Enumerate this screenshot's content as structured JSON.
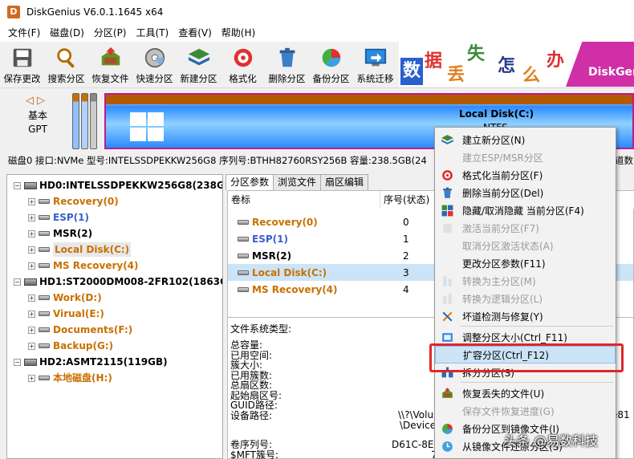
{
  "window": {
    "title": "DiskGenius V6.0.1.1645 x64",
    "logo_letter": "D"
  },
  "menu": [
    "文件(F)",
    "磁盘(D)",
    "分区(P)",
    "工具(T)",
    "查看(V)",
    "帮助(H)"
  ],
  "toolbar": [
    {
      "label": "保存更改",
      "icon": "save-icon"
    },
    {
      "label": "搜索分区",
      "icon": "search-icon"
    },
    {
      "label": "恢复文件",
      "icon": "recover-icon"
    },
    {
      "label": "快速分区",
      "icon": "quick-partition-icon"
    },
    {
      "label": "新建分区",
      "icon": "new-partition-icon"
    },
    {
      "label": "格式化",
      "icon": "format-icon"
    },
    {
      "label": "删除分区",
      "icon": "delete-icon"
    },
    {
      "label": "备份分区",
      "icon": "backup-icon"
    },
    {
      "label": "系统迁移",
      "icon": "migrate-icon"
    }
  ],
  "banner": {
    "tiles": [
      "数",
      "据",
      "丢",
      "失",
      "怎",
      "么",
      "办"
    ],
    "brand": "DiskGen"
  },
  "disk_map": {
    "disk_type_line1": "基本",
    "disk_type_line2": "GPT",
    "partition_name": "Local Disk(C:)",
    "partition_fs": "NTFS"
  },
  "disk_info": "磁盘0 接口:NVMe  型号:INTELSSDPEKKW256G8  序列号:BTHH82760RSY256B  容量:238.5GB(24",
  "disk_info_tail": "道数",
  "tree": [
    {
      "label": "HD0:INTELSSDPEKKW256G8(238GB)",
      "kind": "disk",
      "color": "#000000"
    },
    {
      "label": "Recovery(0)",
      "kind": "part",
      "color": "#c87000"
    },
    {
      "label": "ESP(1)",
      "kind": "part",
      "color": "#3a5fcd"
    },
    {
      "label": "MSR(2)",
      "kind": "part",
      "color": "#000000"
    },
    {
      "label": "Local Disk(C:)",
      "kind": "part",
      "color": "#c87000",
      "selected": true
    },
    {
      "label": "MS Recovery(4)",
      "kind": "part",
      "color": "#c87000"
    },
    {
      "label": "HD1:ST2000DM008-2FR102(1863GB)",
      "kind": "disk",
      "color": "#000000"
    },
    {
      "label": "Work(D:)",
      "kind": "part",
      "color": "#c87000"
    },
    {
      "label": "Virual(E:)",
      "kind": "part",
      "color": "#c87000"
    },
    {
      "label": "Documents(F:)",
      "kind": "part",
      "color": "#c87000"
    },
    {
      "label": "Backup(G:)",
      "kind": "part",
      "color": "#c87000"
    },
    {
      "label": "HD2:ASMT2115(119GB)",
      "kind": "disk",
      "color": "#000000"
    },
    {
      "label": "本地磁盘(H:)",
      "kind": "part",
      "color": "#c87000"
    }
  ],
  "tabs": [
    "分区参数",
    "浏览文件",
    "扇区编辑"
  ],
  "table": {
    "headers": [
      "卷标",
      "序号(状态)",
      "扇"
    ],
    "rows": [
      {
        "label": "Recovery(0)",
        "index": "0",
        "color": "#c87000"
      },
      {
        "label": "ESP(1)",
        "index": "1",
        "color": "#3a5fcd"
      },
      {
        "label": "MSR(2)",
        "index": "2",
        "color": "#000000"
      },
      {
        "label": "Local Disk(C:)",
        "index": "3",
        "color": "#c87000",
        "selected": true
      },
      {
        "label": "MS Recovery(4)",
        "index": "4",
        "color": "#c87000"
      }
    ]
  },
  "props": {
    "fs_type": "文件系统类型:",
    "lines": [
      "总容量:",
      "已用空间:",
      "簇大小:",
      "已用簇数:",
      "总扇区数:",
      "起始扇区号:",
      "GUID路径:",
      "设备路径:"
    ],
    "guid_value": "\\\\?\\Volu",
    "guid_tail": "e81",
    "device_value": "\\Device\\",
    "serial_label": "卷序列号:",
    "serial_value": "D61C-8EC",
    "mft_label": "$MFT簇号:",
    "mft_value": "7"
  },
  "context_menu": [
    {
      "label": "建立新分区(N)",
      "icon": "new-partition-icon",
      "disabled": false
    },
    {
      "label": "建立ESP/MSR分区",
      "icon": "",
      "disabled": true
    },
    {
      "label": "格式化当前分区(F)",
      "icon": "format-icon",
      "disabled": false
    },
    {
      "label": "删除当前分区(Del)",
      "icon": "delete-icon",
      "disabled": false
    },
    {
      "label": "隐藏/取消隐藏 当前分区(F4)",
      "icon": "hide-icon",
      "disabled": false
    },
    {
      "label": "激活当前分区(F7)",
      "icon": "activate-icon",
      "disabled": true
    },
    {
      "label": "取消分区激活状态(A)",
      "icon": "",
      "disabled": true
    },
    {
      "label": "更改分区参数(F11)",
      "icon": "",
      "disabled": false
    },
    {
      "label": "转换为主分区(M)",
      "icon": "convert-primary-icon",
      "disabled": true
    },
    {
      "label": "转换为逻辑分区(L)",
      "icon": "convert-logical-icon",
      "disabled": true
    },
    {
      "label": "坏道检测与修复(Y)",
      "icon": "repair-icon",
      "disabled": false
    },
    {
      "label": "调整分区大小(Ctrl_F11)",
      "icon": "resize-icon",
      "disabled": false
    },
    {
      "label": "扩容分区(Ctrl_F12)",
      "icon": "",
      "disabled": false,
      "highlight": true
    },
    {
      "label": "拆分分区(S)",
      "icon": "split-icon",
      "disabled": false
    },
    {
      "label": "恢复丢失的文件(U)",
      "icon": "recover-icon",
      "disabled": false
    },
    {
      "label": "保存文件恢复进度(G)",
      "icon": "",
      "disabled": true
    },
    {
      "label": "备份分区到镜像文件(I)",
      "icon": "backup-icon",
      "disabled": false
    },
    {
      "label": "从镜像文件还原分区(S)",
      "icon": "restore-icon",
      "disabled": false
    }
  ],
  "watermark": "头条 @易数科技"
}
